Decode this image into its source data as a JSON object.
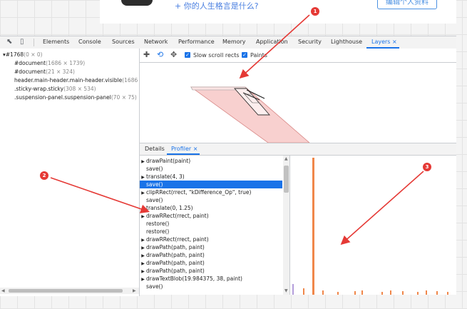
{
  "page": {
    "motto_text": "+ 你的人生格言是什么?",
    "edit_button": "编辑个人资料"
  },
  "devtools": {
    "tabs": [
      {
        "label": "Elements"
      },
      {
        "label": "Console"
      },
      {
        "label": "Sources"
      },
      {
        "label": "Network"
      },
      {
        "label": "Performance"
      },
      {
        "label": "Memory"
      },
      {
        "label": "Application"
      },
      {
        "label": "Security"
      },
      {
        "label": "Lighthouse"
      },
      {
        "label": "Layers",
        "close": "×"
      }
    ],
    "active_tab": "Layers",
    "accent_color": "#1a73e8"
  },
  "layers_tree": [
    {
      "name": "#1768",
      "size": "(0 × 0)"
    },
    {
      "name": "#document",
      "size": "(1686 × 1739)"
    },
    {
      "name": "#document",
      "size": "(21 × 324)"
    },
    {
      "name": "header.main-header.main-header.visible",
      "size": "(1686 ×"
    },
    {
      "name": ".sticky-wrap.sticky",
      "size": "(308 × 534)"
    },
    {
      "name": ".suspension-panel.suspension-panel",
      "size": "(70 × 75)"
    }
  ],
  "toolbar": {
    "icons": [
      "move-icon",
      "rotate-icon",
      "pan-icon"
    ],
    "slow_scroll_label": "Slow scroll rects",
    "paints_label": "Paints",
    "slow_scroll_checked": true,
    "paints_checked": true
  },
  "subtabs": {
    "details": "Details",
    "profiler": "Profiler",
    "close": "×"
  },
  "profiler_commands": [
    {
      "text": "drawPaint(paint)",
      "expandable": true,
      "selected": false
    },
    {
      "text": "save()",
      "expandable": false,
      "selected": false
    },
    {
      "text": "translate(4, 3)",
      "expandable": true,
      "selected": false
    },
    {
      "text": "save()",
      "expandable": false,
      "selected": true
    },
    {
      "text": "clipRRect(rrect, \"kDifference_Op\", true)",
      "expandable": true,
      "selected": false
    },
    {
      "text": "save()",
      "expandable": false,
      "selected": false
    },
    {
      "text": "translate(0, 1.25)",
      "expandable": false,
      "selected": false
    },
    {
      "text": "drawRRect(rrect, paint)",
      "expandable": true,
      "selected": false
    },
    {
      "text": "restore()",
      "expandable": false,
      "selected": false
    },
    {
      "text": "restore()",
      "expandable": false,
      "selected": false
    },
    {
      "text": "drawRRect(rrect, paint)",
      "expandable": true,
      "selected": false
    },
    {
      "text": "drawPath(path, paint)",
      "expandable": true,
      "selected": false
    },
    {
      "text": "drawPath(path, paint)",
      "expandable": true,
      "selected": false
    },
    {
      "text": "drawPath(path, paint)",
      "expandable": true,
      "selected": false
    },
    {
      "text": "drawPath(path, paint)",
      "expandable": true,
      "selected": false
    },
    {
      "text": "drawTextBlob(19.984375, 38, paint)",
      "expandable": true,
      "selected": false
    },
    {
      "text": "save()",
      "expandable": false,
      "selected": false
    }
  ],
  "markers": [
    "1",
    "2",
    "3"
  ],
  "colors": {
    "annotation_red": "#e53935",
    "layer_fill": "#f8d0cf",
    "timing_bar": "#f0874a",
    "timing_bar_alt": "#b39ddb"
  }
}
